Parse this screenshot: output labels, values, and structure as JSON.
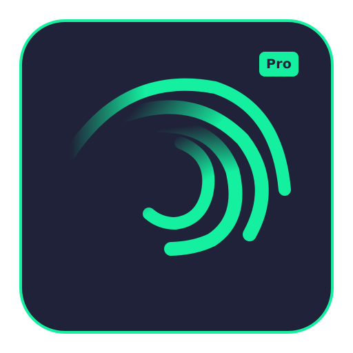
{
  "app_icon": {
    "icon_name": "alight-motion-swirl-icon",
    "badge_label": "Pro",
    "colors": {
      "accent": "#14f0a0",
      "background": "#1f2238",
      "page": "#ffffff"
    }
  }
}
